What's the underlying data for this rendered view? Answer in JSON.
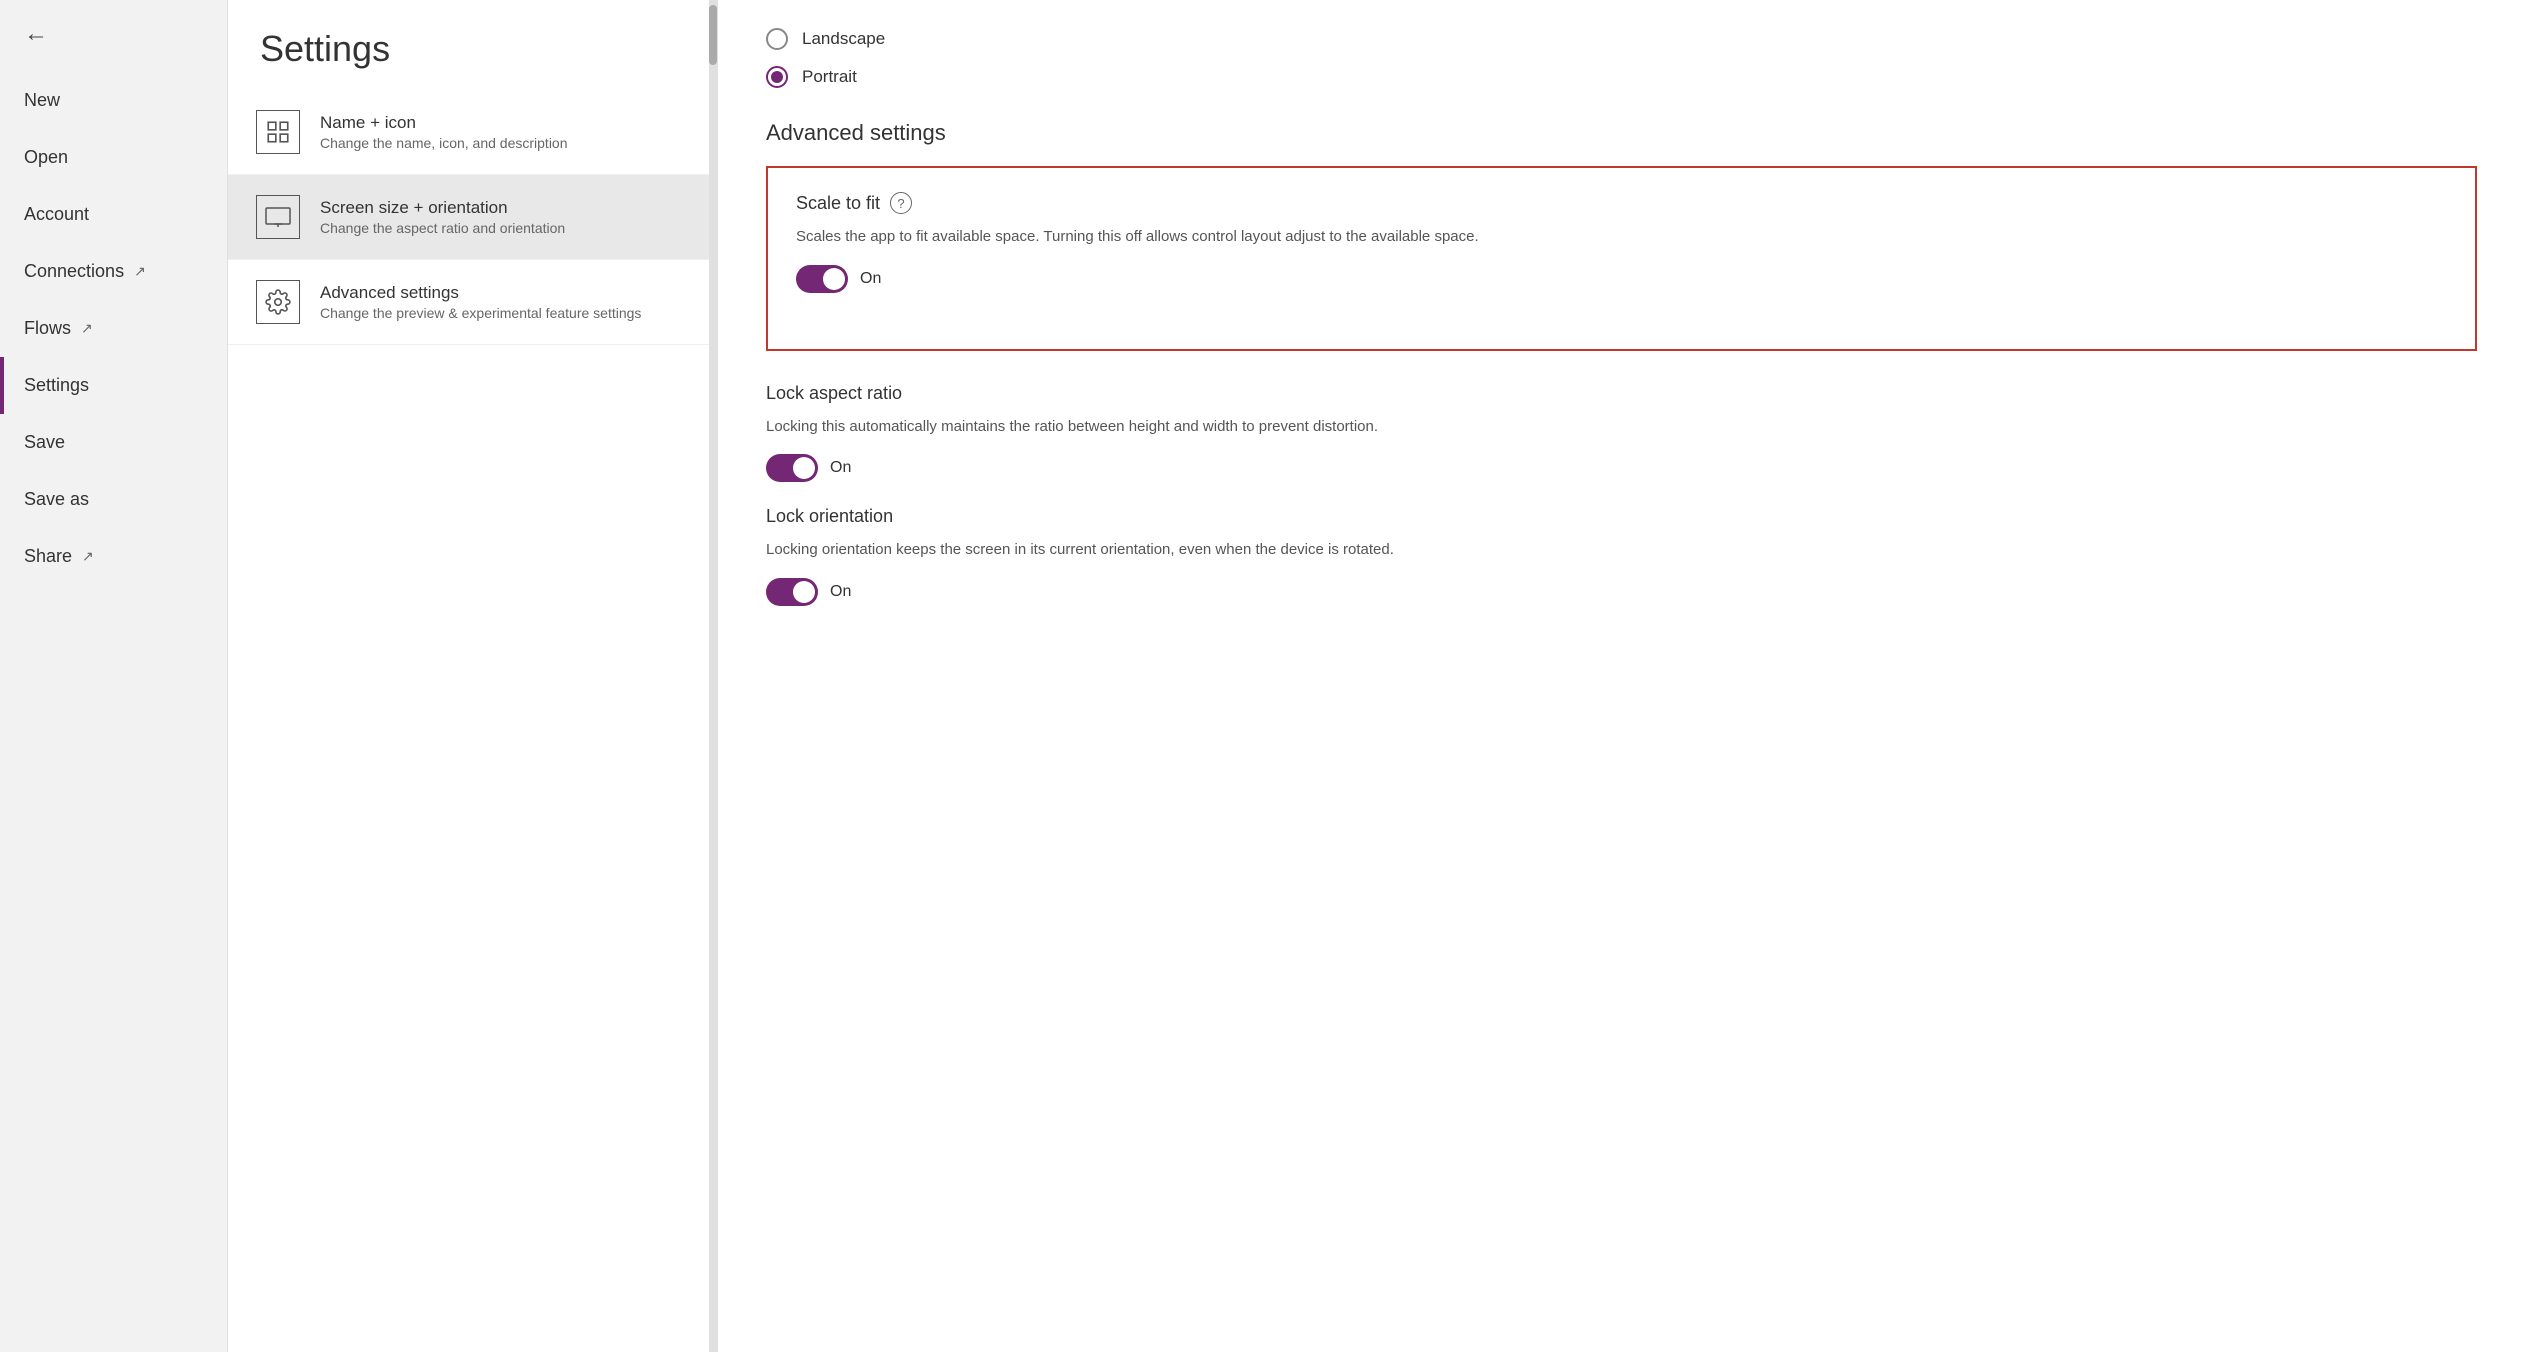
{
  "sidebar": {
    "back_label": "←",
    "items": [
      {
        "id": "new",
        "label": "New",
        "active": false,
        "external": false
      },
      {
        "id": "open",
        "label": "Open",
        "active": false,
        "external": false
      },
      {
        "id": "account",
        "label": "Account",
        "active": false,
        "external": false
      },
      {
        "id": "connections",
        "label": "Connections",
        "active": false,
        "external": true
      },
      {
        "id": "flows",
        "label": "Flows",
        "active": false,
        "external": true
      },
      {
        "id": "settings",
        "label": "Settings",
        "active": true,
        "external": false
      },
      {
        "id": "save",
        "label": "Save",
        "active": false,
        "external": false
      },
      {
        "id": "save-as",
        "label": "Save as",
        "active": false,
        "external": false
      },
      {
        "id": "share",
        "label": "Share",
        "active": false,
        "external": true
      }
    ]
  },
  "page_title": "Settings",
  "settings_nav": [
    {
      "id": "name-icon",
      "title": "Name + icon",
      "subtitle": "Change the name, icon, and description",
      "active": false,
      "icon": "grid"
    },
    {
      "id": "screen-size",
      "title": "Screen size + orientation",
      "subtitle": "Change the aspect ratio and orientation",
      "active": true,
      "icon": "monitor"
    },
    {
      "id": "advanced",
      "title": "Advanced settings",
      "subtitle": "Change the preview & experimental feature settings",
      "active": false,
      "icon": "gear"
    }
  ],
  "orientation": {
    "landscape": {
      "label": "Landscape",
      "selected": false
    },
    "portrait": {
      "label": "Portrait",
      "selected": true
    }
  },
  "advanced_settings": {
    "section_title": "Advanced settings",
    "scale_to_fit": {
      "title": "Scale to fit",
      "description": "Scales the app to fit available space. Turning this off allows control layout adjust to the available space.",
      "toggle_value": "On",
      "enabled": true
    },
    "lock_aspect_ratio": {
      "title": "Lock aspect ratio",
      "description": "Locking this automatically maintains the ratio between height and width to prevent distortion.",
      "toggle_value": "On",
      "enabled": true
    },
    "lock_orientation": {
      "title": "Lock orientation",
      "description": "Locking orientation keeps the screen in its current orientation, even when the device is rotated.",
      "toggle_value": "On",
      "enabled": true
    }
  }
}
